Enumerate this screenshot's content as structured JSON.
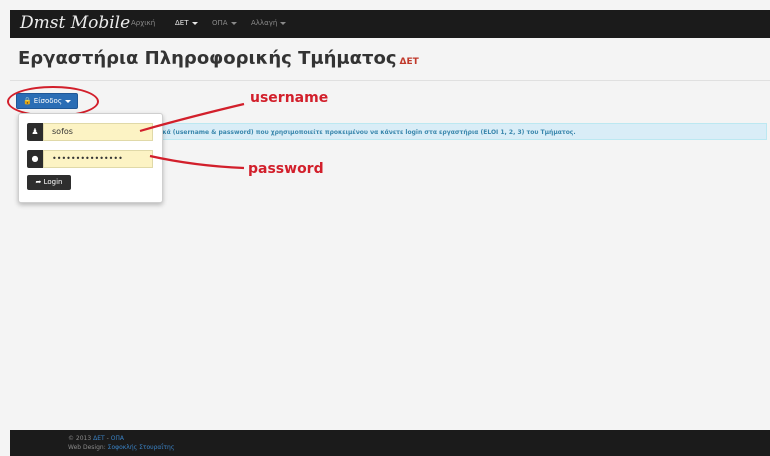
{
  "navbar": {
    "brand": "Dmst Mobile",
    "items": [
      {
        "label": "Αρχική",
        "active": false,
        "dropdown": false
      },
      {
        "label": "ΔΕΤ",
        "active": true,
        "dropdown": true
      },
      {
        "label": "ΟΠΑ",
        "active": false,
        "dropdown": true
      },
      {
        "label": "Αλλαγή",
        "active": false,
        "dropdown": true
      }
    ]
  },
  "page": {
    "title": "Εργαστήρια Πληροφορικής Τμήματος",
    "title_accent": "ΔΕΤ"
  },
  "login_dropdown": {
    "toggle_label": "Είσοδος",
    "username_value": "sofos",
    "password_value": "•••••••••••••••",
    "submit_label": "Login"
  },
  "info_text": "ικά (username & password) που χρησιμοποιείτε προκειμένου να κάνετε login στα εργαστήρια (ELOI 1, 2, 3) του Τμήματος.",
  "annotations": {
    "username_label": "username",
    "password_label": "password",
    "color": "#d21f2b"
  },
  "footer": {
    "copyright_prefix": "© 2013",
    "link_det": "ΔΕΤ",
    "separator": "-",
    "link_opa": "ΟΠΑ",
    "design_prefix": "Web Design:",
    "designer": "Σοφοκλής Στουραΐτης"
  },
  "icons": {
    "lock": "lock-icon",
    "user": "user-icon",
    "key": "key-icon",
    "login": "login-icon"
  },
  "colors": {
    "navbar_bg": "#1b1b1b",
    "primary_btn": "#2a6db5",
    "input_bg": "#fcf3c4",
    "info_bg": "#d9edf7",
    "info_text": "#3a87ad"
  }
}
